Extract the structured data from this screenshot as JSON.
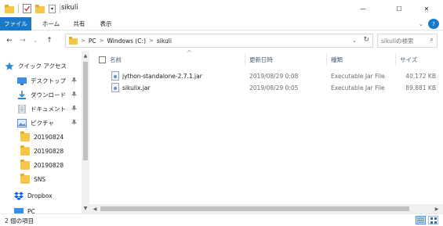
{
  "window": {
    "title": "sikuli",
    "minimize": "—",
    "maximize": "☐",
    "close": "✕",
    "qat_dropdown": "▾"
  },
  "ribbon": {
    "tabs": [
      {
        "label": "ファイル"
      },
      {
        "label": "ホーム"
      },
      {
        "label": "共有"
      },
      {
        "label": "表示"
      }
    ],
    "collapse": "⌄",
    "help": "?"
  },
  "nav": {
    "back": "←",
    "forward": "→",
    "recent": "⌄",
    "up": "↑"
  },
  "address": {
    "crumbs": [
      "PC",
      "Windows (C:)",
      "sikuli"
    ],
    "separator": ">",
    "dropdown": "⌄",
    "refresh": "↻"
  },
  "search": {
    "placeholder": "sikuliの検索",
    "icon": "⌕"
  },
  "navpane": {
    "quick_access": "クイック アクセス",
    "items": [
      {
        "label": "デスクトップ",
        "icon": "desktop-icon",
        "pinned": true
      },
      {
        "label": "ダウンロード",
        "icon": "download-icon",
        "pinned": true
      },
      {
        "label": "ドキュメント",
        "icon": "document-icon",
        "pinned": true
      },
      {
        "label": "ピクチャ",
        "icon": "picture-icon",
        "pinned": true
      },
      {
        "label": "20190824",
        "icon": "folder-icon",
        "pinned": false
      },
      {
        "label": "20190828",
        "icon": "folder-icon",
        "pinned": false
      },
      {
        "label": "20190828",
        "icon": "folder-icon",
        "pinned": false
      },
      {
        "label": "SNS",
        "icon": "folder-icon",
        "pinned": false
      }
    ],
    "dropbox": "Dropbox",
    "pc": "PC",
    "pin_glyph": "📌"
  },
  "columns": {
    "name": "名前",
    "modified": "更新日時",
    "type": "種類",
    "size": "サイズ",
    "sort_caret": "^"
  },
  "files": [
    {
      "name": "jython-standalone-2.7.1.jar",
      "modified": "2019/08/29 0:08",
      "type": "Executable Jar File",
      "size": "40,172 KB"
    },
    {
      "name": "sikulix.jar",
      "modified": "2019/08/29 0:05",
      "type": "Executable Jar File",
      "size": "89,881 KB"
    }
  ],
  "scroll": {
    "up": "▲",
    "down": "▼",
    "left": "◀",
    "right": "▶"
  },
  "status": {
    "item_count": "2 個の項目"
  },
  "colors": {
    "accent": "#1979ca",
    "folder": "#f4c64a"
  }
}
